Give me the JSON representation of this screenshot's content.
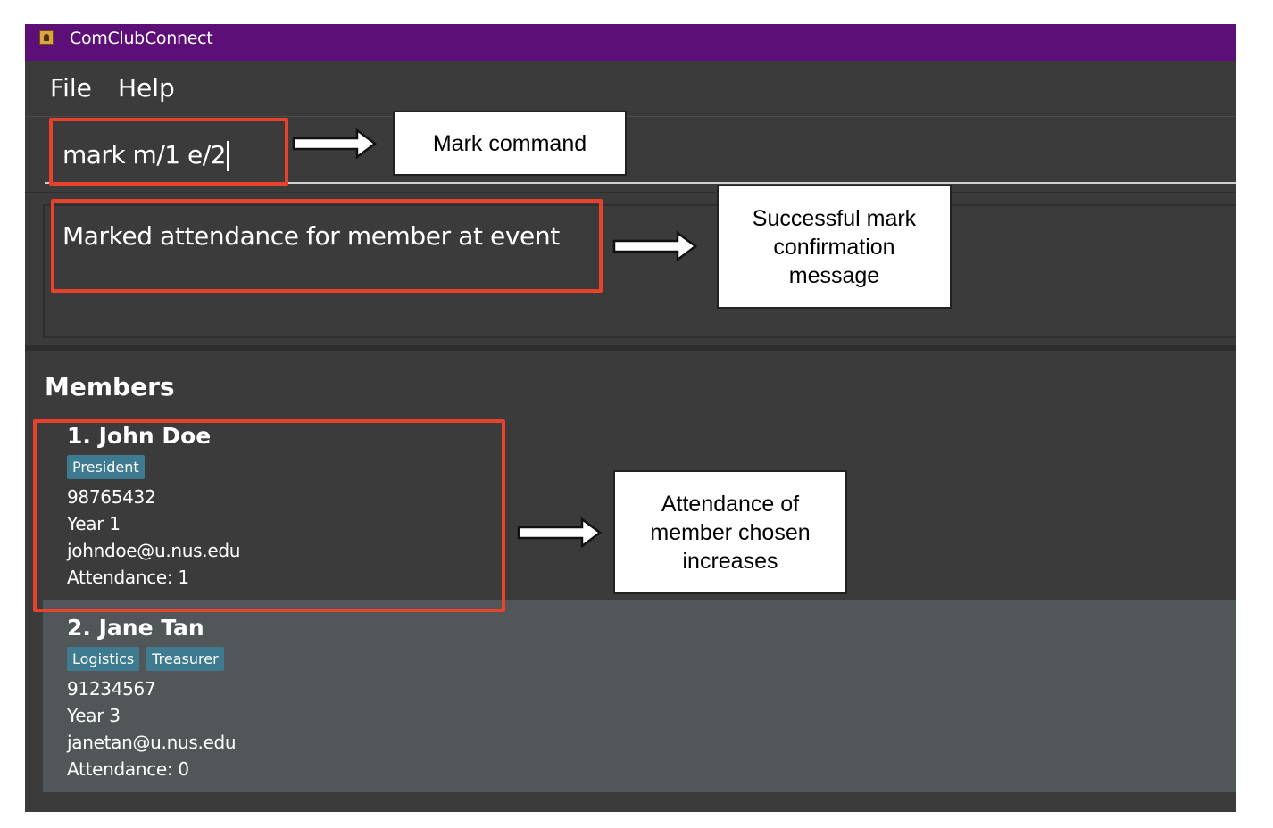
{
  "window": {
    "title": "ComClubConnect",
    "icon": "address-book-icon"
  },
  "menu": {
    "file": "File",
    "help": "Help"
  },
  "command": {
    "value": "mark m/1 e/2"
  },
  "result": {
    "message": "Marked attendance for member at event"
  },
  "members": {
    "heading": "Members",
    "list": [
      {
        "name": "1. John Doe",
        "tags": [
          "President"
        ],
        "phone": "98765432",
        "year": "Year 1",
        "email": "johndoe@u.nus.edu",
        "attendance": "Attendance: 1"
      },
      {
        "name": "2. Jane Tan",
        "tags": [
          "Logistics",
          "Treasurer"
        ],
        "phone": "91234567",
        "year": "Year 3",
        "email": "janetan@u.nus.edu",
        "attendance": "Attendance: 0"
      }
    ]
  },
  "annotations": {
    "command_note": "Mark command",
    "result_note_l1": "Successful mark",
    "result_note_l2": "confirmation",
    "result_note_l3": "message",
    "member_note_l1": "Attendance of",
    "member_note_l2": "member chosen",
    "member_note_l3": "increases"
  },
  "colors": {
    "titlebar": "#5d0f78",
    "background": "#3b3b3b",
    "highlight": "#e8412c",
    "tag": "#3e7b91"
  }
}
